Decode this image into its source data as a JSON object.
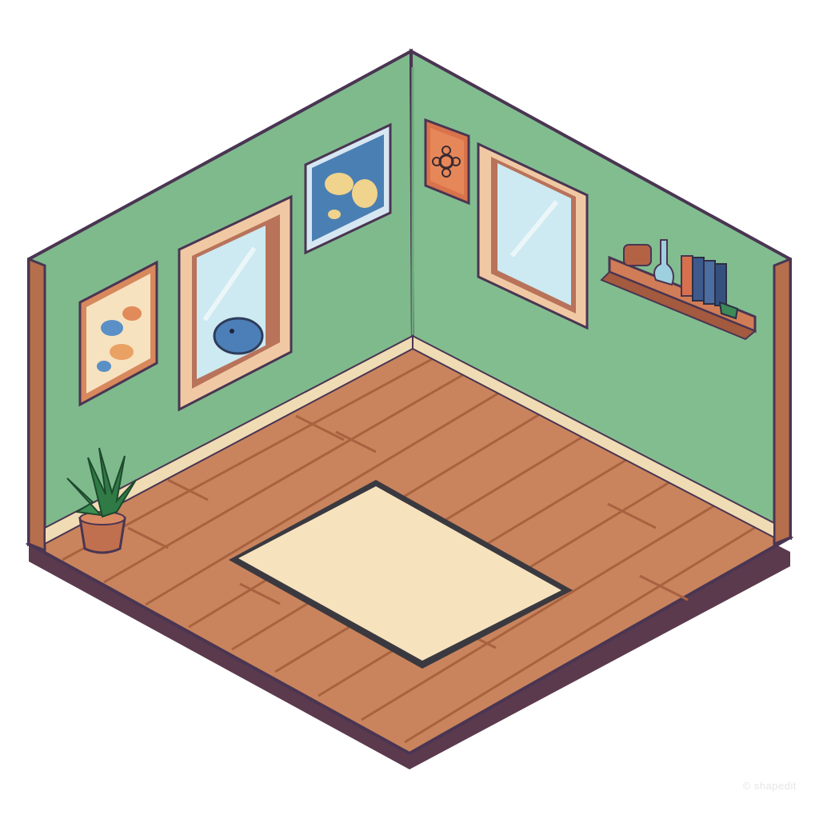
{
  "scene": {
    "description_free": true,
    "palette": {
      "wall_left": "#7fba8d",
      "wall_right": "#82bd90",
      "wall_shadow": "#6da97c",
      "outline": "#4a3552",
      "floor": "#c9845d",
      "floor_line": "#a8623f",
      "floor_base": "#5b3a4e",
      "skirting": "#f0dcb4",
      "wall_edge": "#b66f4c",
      "rug": "#f6e3bd",
      "rug_fringe": "#3b3940",
      "window_frame": "#f0c9a4",
      "window_frame_dark": "#b8735a",
      "glass": "#cde9f2",
      "poster_blue": "#4a7fb3",
      "shelf": "#d07d57",
      "plant_green": "#2f7a45",
      "pot": "#c0704e"
    },
    "objects": [
      {
        "name": "left-wall",
        "kind": "wall"
      },
      {
        "name": "right-wall",
        "kind": "wall"
      },
      {
        "name": "wooden-floor",
        "kind": "floor"
      },
      {
        "name": "rug",
        "kind": "decor"
      },
      {
        "name": "map-poster-left",
        "kind": "decor"
      },
      {
        "name": "window-left",
        "kind": "window"
      },
      {
        "name": "map-poster-blue",
        "kind": "decor"
      },
      {
        "name": "flower-picture",
        "kind": "decor"
      },
      {
        "name": "window-right",
        "kind": "window"
      },
      {
        "name": "wall-shelf",
        "kind": "furniture"
      },
      {
        "name": "potted-plant",
        "kind": "decor"
      }
    ]
  },
  "watermark": "© shapedit"
}
